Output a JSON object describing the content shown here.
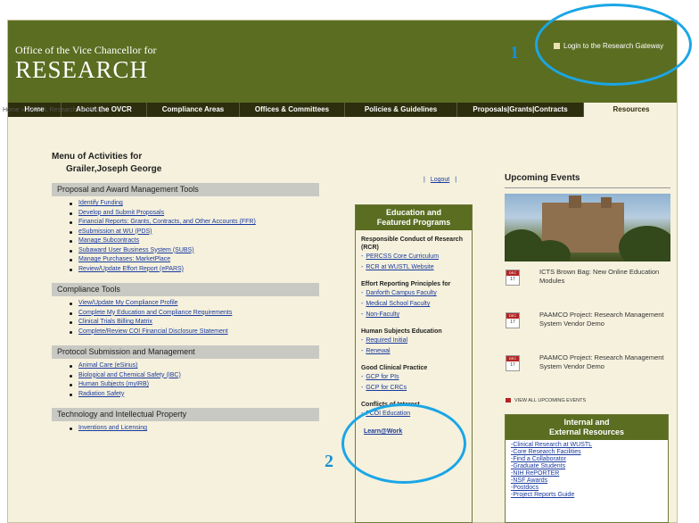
{
  "header": {
    "office": "Office of the Vice Chancellor for",
    "research": "RESEARCH",
    "login": "Login to the Research Gateway"
  },
  "nav": [
    "Home",
    "About the OVCR",
    "Compliance Areas",
    "Offices & Committees",
    "Policies & Guidelines",
    "Proposals|Grants|Contracts",
    "Resources"
  ],
  "breadcrumb": "Home » WUSTL Research Gateway",
  "menu": {
    "title": "Menu of Activities for",
    "name": "Grailer,Joseph George",
    "sections": [
      {
        "title": "Proposal and Award Management Tools",
        "links": [
          "Identify Funding",
          "Develop and Submit Proposals",
          "Financial Reports: Grants, Contracts, and Other Accounts (FFR)",
          "eSubmission at WU (PDS)",
          "Manage Subcontracts",
          "Subaward User Business System (SUBS)",
          "Manage Purchases: MarketPlace",
          "Review/Update Effort Report (ePARS)"
        ]
      },
      {
        "title": "Compliance Tools",
        "links": [
          "View/Update My Compliance Profile",
          "Complete My Education and Compliance Requirements",
          "Clinical Trials Billing Matrix",
          "Complete/Review COI Financial Disclosure Statement"
        ]
      },
      {
        "title": "Protocol Submission and Management",
        "links": [
          "Animal Care (eSirius)",
          "Biological and Chemical Safety (IBC)",
          "Human Subjects (myIRB)",
          "Radiation Safety"
        ]
      },
      {
        "title": "Technology and Intellectual Property",
        "links": [
          "Inventions and Licensing"
        ]
      }
    ]
  },
  "logout": "Logout",
  "education": {
    "title1": "Education and",
    "title2": "Featured Programs",
    "rcr_head": "Responsible Conduct of Research (RCR)",
    "rcr_links": [
      "PERCSS Core Curriculum",
      "RCR at WUSTL Website"
    ],
    "effort_head": "Effort Reporting Principles for",
    "effort_links": [
      "Danforth Campus Faculty",
      "Medical School Faculty",
      "Non-Faculty"
    ],
    "hs_head": "Human Subjects Education",
    "hs_links": [
      "Required Initial",
      "Renewal"
    ],
    "gcp_head": "Good Clinical Practice",
    "gcp_links": [
      "GCP for PIs",
      "GCP for CRCs"
    ],
    "coi_head": "Conflicts of Interest",
    "coi_links": [
      "FCOI Education"
    ],
    "learn": "Learn@Work"
  },
  "events": {
    "title": "Upcoming Events",
    "items": [
      {
        "month": "DEC",
        "day": "17",
        "text": "ICTS Brown Bag: New Online Education Modules"
      },
      {
        "month": "DEC",
        "day": "17",
        "text": "PAAMCO Project: Research Management System Vendor Demo"
      },
      {
        "month": "DEC",
        "day": "17",
        "text": "PAAMCO Project: Research Management System Vendor Demo"
      }
    ],
    "view_all": "VIEW ALL UPCOMING EVENTS"
  },
  "resources": {
    "title1": "Internal and",
    "title2": "External Resources",
    "links": [
      "Clinical Research at WUSTL",
      "Core Research Facilities",
      "Find a Collaborator",
      "Graduate Students",
      "NIH RePORTER",
      "NSF Awards",
      "Postdocs",
      "Project Reports Guide"
    ]
  },
  "annotations": {
    "one": "1",
    "two": "2"
  }
}
